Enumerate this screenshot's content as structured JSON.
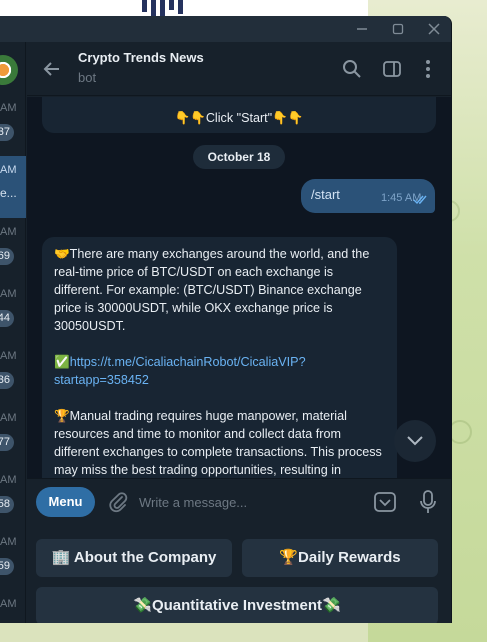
{
  "chat": {
    "title": "Crypto Trends News",
    "subtitle": "bot"
  },
  "chat_list": {
    "items": [
      {
        "time": "AM",
        "badge": "37"
      },
      {
        "time": "AM",
        "sub": "e..."
      },
      {
        "time": "AM",
        "badge": "69"
      },
      {
        "time": "AM",
        "badge": "44"
      },
      {
        "time": "AM",
        "badge": "36"
      },
      {
        "time": "AM",
        "badge": "77"
      },
      {
        "time": "AM",
        "badge": "58"
      },
      {
        "time": "AM",
        "badge": "59"
      },
      {
        "time": "AM",
        "badge": ""
      }
    ]
  },
  "messages": {
    "top_text": "👇👇Click \"Start\"👇👇",
    "date": "October 18",
    "outgoing": {
      "text": "/start",
      "time": "1:45 AM"
    },
    "incoming": {
      "p1": "🤝There are many exchanges around the world, and the real-time price of BTC/USDT on each exchange is different. For example: (BTC/USDT) Binance exchange price is 30000USDT, while OKX exchange price is 30050USDT.",
      "p2_prefix": "✅",
      "p2_link": "https://t.me/CicaliachainRobot/CicaliaVIP?startapp=358452",
      "p3": "🏆Manual trading requires huge manpower, material resources and time to monitor and collect data from different exchanges to complete transactions. This process may miss the best trading opportunities, resulting in reduced profits or even asset shrinkage."
    }
  },
  "composer": {
    "menu_label": "Menu",
    "placeholder": "Write a message..."
  },
  "keyboard": {
    "btn1": "🏢 About the Company",
    "btn2": "🏆Daily Rewards",
    "btn3": "💸Quantitative Investment💸"
  },
  "colors": {
    "window_bg": "#17212b",
    "chat_bg": "#0e1621",
    "bubble_in": "#182533",
    "bubble_out": "#2b5278",
    "accent": "#2f6ea5",
    "link": "#6ab3f3"
  },
  "icons": [
    "back-arrow-icon",
    "search-icon",
    "sidebar-toggle-icon",
    "more-vert-icon",
    "attach-icon",
    "keyboard-icon",
    "microphone-icon",
    "chevron-down-icon",
    "double-check-icon",
    "minimize-icon",
    "maximize-icon",
    "close-icon"
  ]
}
